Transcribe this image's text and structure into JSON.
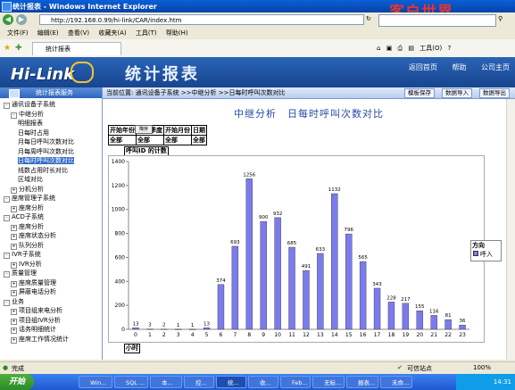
{
  "browser": {
    "title": "统计报表 - Windows Internet Explorer",
    "watermark": "客户世界",
    "url": "http://192.168.0.99/hi-link/CAR/index.htm",
    "menu": [
      "文件(F)",
      "编辑(E)",
      "查看(V)",
      "收藏夹(A)",
      "工具(T)",
      "帮助(H)"
    ],
    "tab_label": "统计报表",
    "tools_label": "工具(O)"
  },
  "app": {
    "logo_text": "Hi-Link",
    "title": "统计报表",
    "links": [
      "返回首页",
      "帮助",
      "公司主页"
    ]
  },
  "sidebar": {
    "header": "统计报表服务",
    "items": [
      {
        "label": "通讯设备子系统",
        "box": "-"
      },
      {
        "label": "中继分析",
        "box": "-"
      },
      {
        "label": "明细报表",
        "box": ""
      },
      {
        "label": "日每时占用",
        "box": ""
      },
      {
        "label": "月每日呼叫次数对比",
        "box": ""
      },
      {
        "label": "月每周呼叫次数对比",
        "box": ""
      },
      {
        "label": "日每时呼叫次数对比",
        "box": "",
        "selected": true
      },
      {
        "label": "线数占用时长对比",
        "box": ""
      },
      {
        "label": "区域对比",
        "box": ""
      },
      {
        "label": "分机分析",
        "box": "+"
      },
      {
        "label": "座席管理子系统",
        "box": "-"
      },
      {
        "label": "座席分析",
        "box": "+"
      },
      {
        "label": "ACD子系统",
        "box": "-"
      },
      {
        "label": "座席分析",
        "box": "+"
      },
      {
        "label": "座席状态分析",
        "box": "+"
      },
      {
        "label": "队列分析",
        "box": "+"
      },
      {
        "label": "IVR子系统",
        "box": "-"
      },
      {
        "label": "IVR分析",
        "box": "+"
      },
      {
        "label": "质量管理",
        "box": "-"
      },
      {
        "label": "座席质量管理",
        "box": "+"
      },
      {
        "label": "屏蔽电话分析",
        "box": "+"
      },
      {
        "label": "业务",
        "box": "-"
      },
      {
        "label": "项目组来电分析",
        "box": "+"
      },
      {
        "label": "项目组IVR分析",
        "box": "+"
      },
      {
        "label": "话务明细统计",
        "box": "+"
      },
      {
        "label": "座席工作情况统计",
        "box": "+"
      }
    ]
  },
  "breadcrumb": {
    "prefix": "当前位置:",
    "path": "通讯设备子系统 >>中继分析 >>日每时呼叫次数对比"
  },
  "actions": [
    "模板保存",
    "数据导入",
    "数据导出"
  ],
  "report": {
    "title": "中继分析　日每时呼叫次数对比",
    "filters": {
      "headers": [
        "开始年份",
        "开始季度",
        "开始月份",
        "日期"
      ],
      "values": [
        "全部",
        "全部",
        "全部",
        "全部"
      ],
      "dropdown_label": "降序"
    },
    "chart_label": "呼叫ID 的计数",
    "x_label": "小时",
    "legend_title": "方向",
    "legend_item": "呼入"
  },
  "status": {
    "left": "完成",
    "zone": "可信站点",
    "zoom": "100%"
  },
  "taskbar": {
    "start": "开始",
    "items": [
      "Win...",
      "SQL ...",
      "本...",
      "控...",
      "统...",
      "收...",
      "Feb...",
      "无标...",
      "报表...",
      "未命..."
    ],
    "clock": "14:31"
  },
  "colors": {
    "bar": "#7b7bee",
    "accent": "#2f66bd"
  },
  "chart_data": {
    "type": "bar",
    "title": "",
    "xlabel": "小时",
    "ylabel": "呼叫ID 的计数",
    "categories": [
      "0",
      "1",
      "2",
      "3",
      "4",
      "5",
      "6",
      "7",
      "8",
      "9",
      "10",
      "11",
      "12",
      "13",
      "14",
      "15",
      "16",
      "17",
      "18",
      "19",
      "20",
      "21",
      "22",
      "23"
    ],
    "series": [
      {
        "name": "呼入",
        "values": [
          13,
          3,
          2,
          1,
          1,
          13,
          374,
          693,
          1256,
          900,
          932,
          685,
          491,
          633,
          1132,
          796,
          565,
          343,
          228,
          217,
          155,
          116,
          81,
          36
        ]
      }
    ],
    "ylim": [
      0,
      1400
    ],
    "yticks": [
      0,
      200,
      400,
      600,
      800,
      1000,
      1200,
      1400
    ],
    "grid": false,
    "legend": "right"
  }
}
